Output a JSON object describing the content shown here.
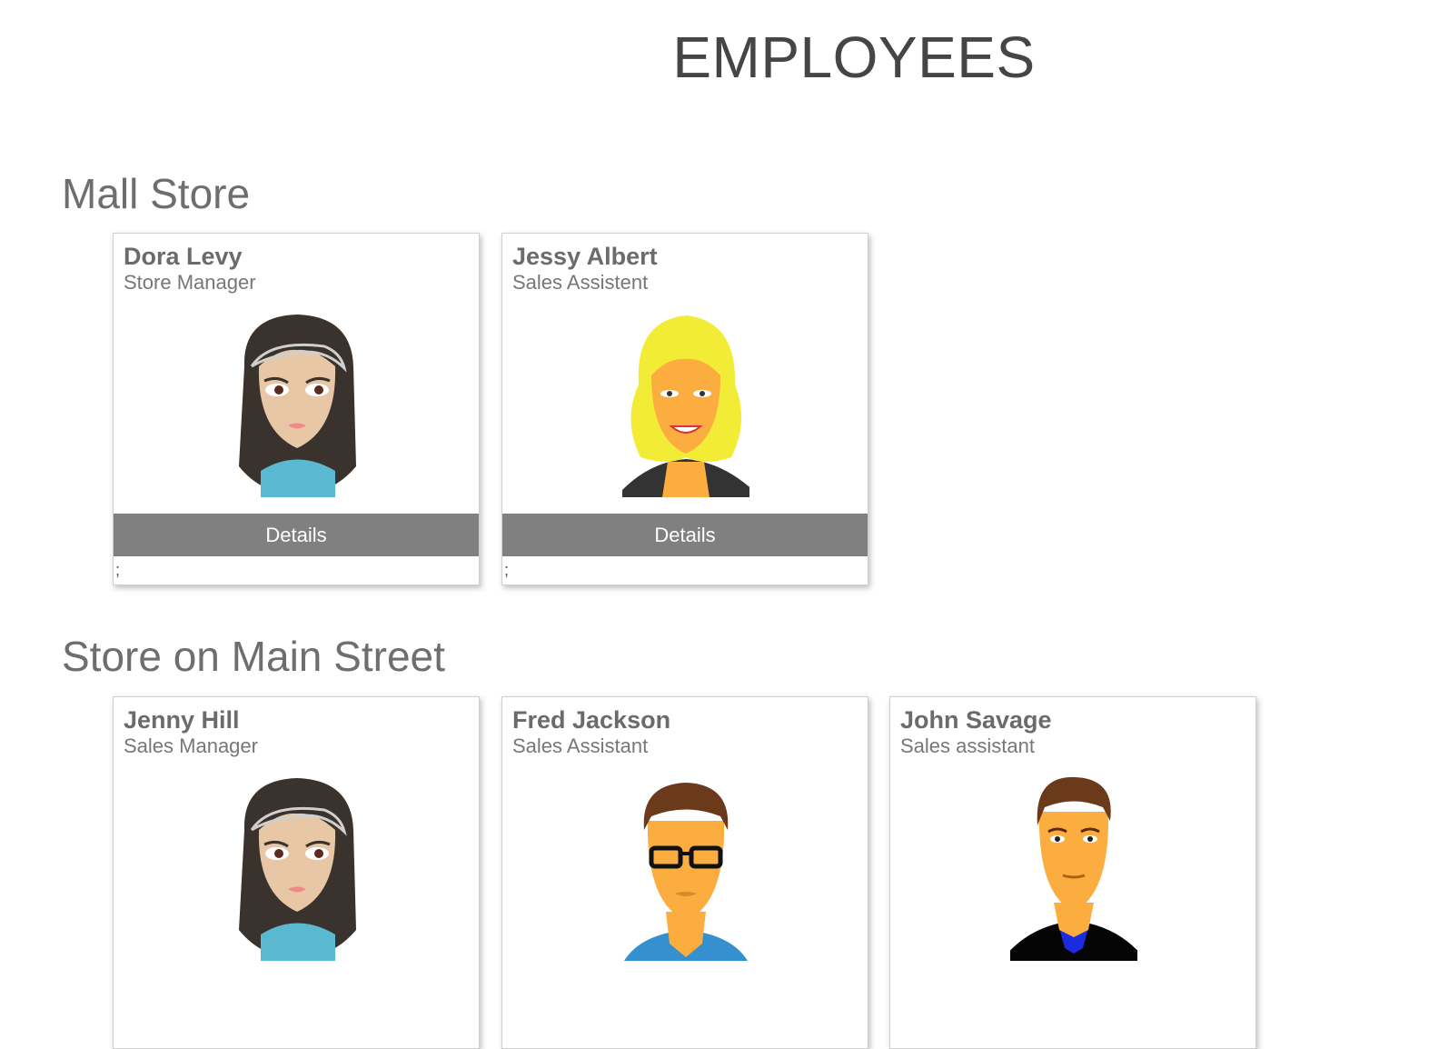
{
  "page": {
    "title": "EMPLOYEES"
  },
  "groups": [
    {
      "title": "Mall Store",
      "employees": [
        {
          "name": "Dora Levy",
          "role": "Store Manager",
          "avatar": "woman-dark-hair-avatar",
          "button": "Details",
          "separator": ";"
        },
        {
          "name": "Jessy Albert",
          "role": "Sales Assistent",
          "avatar": "woman-blonde-avatar",
          "button": "Details",
          "separator": ";"
        }
      ]
    },
    {
      "title": "Store on Main Street",
      "employees": [
        {
          "name": "Jenny Hill",
          "role": "Sales Manager",
          "avatar": "woman-dark-hair-avatar"
        },
        {
          "name": "Fred Jackson",
          "role": "Sales Assistant",
          "avatar": "man-glasses-avatar"
        },
        {
          "name": "John Savage",
          "role": "Sales assistant",
          "avatar": "man-black-shirt-avatar"
        }
      ]
    }
  ],
  "colors": {
    "button_bg": "#808080",
    "title_text": "#454545",
    "name_text": "#6b6b6b"
  }
}
